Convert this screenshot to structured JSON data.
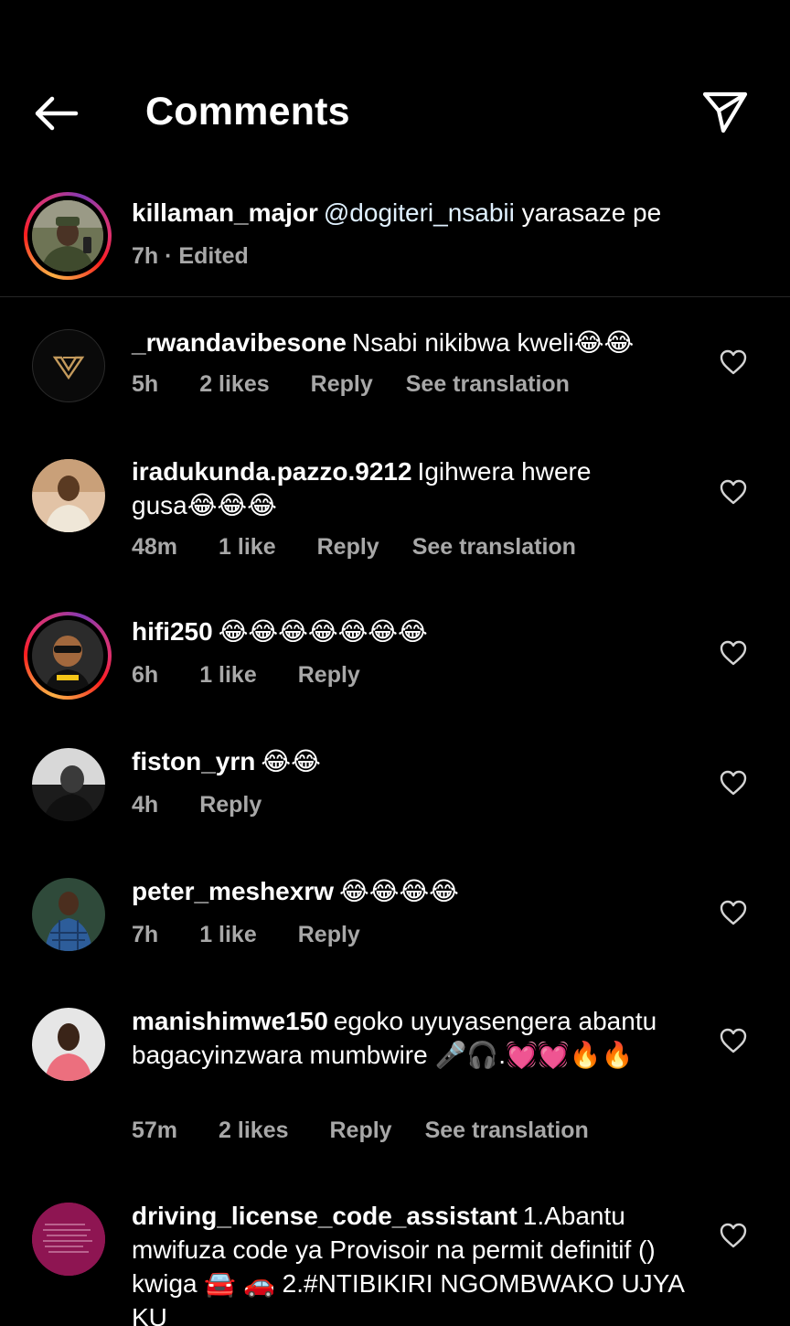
{
  "header": {
    "title": "Comments",
    "back_icon": "arrow-left-icon",
    "share_icon": "send-icon"
  },
  "caption": {
    "username": "killaman_major",
    "mention": "@dogiteri_nsabii",
    "text": " yarasaze pe",
    "meta": "7h · Edited"
  },
  "comments": [
    {
      "username": "_rwandavibesone",
      "text": "Nsabi nikibwa kweli😂😂",
      "time": "5h",
      "likes": "2 likes",
      "reply": "Reply",
      "translate": "See translation"
    },
    {
      "username": "iradukunda.pazzo.9212",
      "text": "Igihwera hwere gusa😂😂😂",
      "time": "48m",
      "likes": "1 like",
      "reply": "Reply",
      "translate": "See translation"
    },
    {
      "username": "hifi250",
      "text": "😂😂😂😂😂😂😂",
      "time": "6h",
      "likes": "1 like",
      "reply": "Reply"
    },
    {
      "username": "fiston_yrn",
      "text": "😂😂",
      "time": "4h",
      "reply": "Reply"
    },
    {
      "username": "peter_meshexrw",
      "text": "😂😂😂😂",
      "time": "7h",
      "likes": "1 like",
      "reply": "Reply"
    },
    {
      "username": "manishimwe150",
      "text": "egoko uyuyasengera abantu bagacyinzwara mumbwire 🎤🎧.💓💓🔥🔥",
      "time": "57m",
      "likes": "2 likes",
      "reply": "Reply",
      "translate": "See translation"
    },
    {
      "username": "driving_license_code_assistant",
      "text": "1.Abantu mwifuza code ya Provisoir na permit definitif () kwiga 🚘 🚗 2.#NTIBIKIRI NGOMBWAKO UJYA KU",
      "time": "",
      "reply": ""
    }
  ],
  "colors": {
    "background": "#000000",
    "meta_text": "#a8a8a8",
    "divider": "#262626"
  }
}
